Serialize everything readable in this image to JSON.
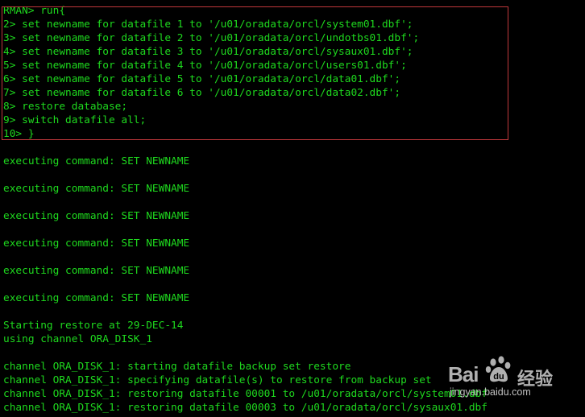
{
  "terminal": {
    "text_color": "#1ed91e",
    "background_color": "#000000",
    "highlight_color": "#c0383c",
    "lines": [
      "RMAN> run{",
      "2> set newname for datafile 1 to '/u01/oradata/orcl/system01.dbf';",
      "3> set newname for datafile 2 to '/u01/oradata/orcl/undotbs01.dbf';",
      "4> set newname for datafile 3 to '/u01/oradata/orcl/sysaux01.dbf';",
      "5> set newname for datafile 4 to '/u01/oradata/orcl/users01.dbf';",
      "6> set newname for datafile 5 to '/u01/oradata/orcl/data01.dbf';",
      "7> set newname for datafile 6 to '/u01/oradata/orcl/data02.dbf';",
      "8> restore database;",
      "9> switch datafile all;",
      "10> }",
      "",
      "executing command: SET NEWNAME",
      "",
      "executing command: SET NEWNAME",
      "",
      "executing command: SET NEWNAME",
      "",
      "executing command: SET NEWNAME",
      "",
      "executing command: SET NEWNAME",
      "",
      "executing command: SET NEWNAME",
      "",
      "Starting restore at 29-DEC-14",
      "using channel ORA_DISK_1",
      "",
      "channel ORA_DISK_1: starting datafile backup set restore",
      "channel ORA_DISK_1: specifying datafile(s) to restore from backup set",
      "channel ORA_DISK_1: restoring datafile 00001 to /u01/oradata/orcl/system01.dbf",
      "channel ORA_DISK_1: restoring datafile 00003 to /u01/oradata/orcl/sysaux01.dbf"
    ]
  },
  "watermark": {
    "brand": "Bai",
    "brand_icon": "baidu-paw-icon",
    "cn_text": "经验",
    "url": "jingyan.baidu.com"
  }
}
